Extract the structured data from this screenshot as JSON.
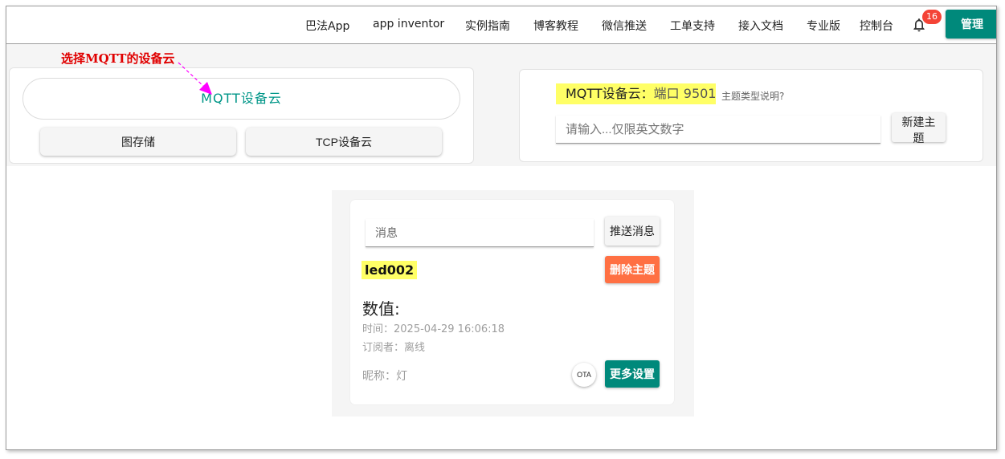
{
  "nav": {
    "items": [
      {
        "label": "巴法App"
      },
      {
        "label": "app inventor"
      },
      {
        "label": "实例指南"
      },
      {
        "label": "博客教程"
      },
      {
        "label": "微信推送"
      },
      {
        "label": "工单支持"
      },
      {
        "label": "接入文档"
      },
      {
        "label": "专业版"
      },
      {
        "label": "控制台"
      }
    ],
    "notification_count": "16",
    "admin_label": "管理"
  },
  "annotation": {
    "text": "选择MQTT的设备云",
    "color": "#e00000",
    "arrow_color": "#ff00ff"
  },
  "cloud_select": {
    "mqtt_label": "MQTT设备云",
    "storage_label": "图存储",
    "tcp_label": "TCP设备云"
  },
  "topic_panel": {
    "title": "MQTT设备云：",
    "port_text": "端口 9501",
    "help_link": "主题类型说明?",
    "input_placeholder": "请输入...仅限英文数字",
    "new_topic_label": "新建主题"
  },
  "device": {
    "message_placeholder": "消息",
    "push_label": "推送消息",
    "topic_name": "led002",
    "delete_label": "删除主题",
    "value_label": "数值:",
    "time_text": "时间：2025-04-29 16:06:18",
    "subscriber_text": "订阅者：离线",
    "nickname_text": "昵称：灯",
    "ota_label": "OTA",
    "more_label": "更多设置"
  },
  "colors": {
    "accent": "#00897b",
    "danger": "#ff7043",
    "badge": "#f44336",
    "highlight": "#ffff66"
  }
}
